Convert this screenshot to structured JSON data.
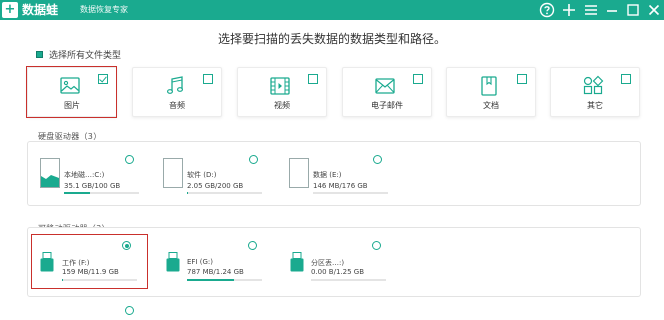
{
  "titlebar": {
    "logo": "+",
    "app_name": "数据蛙",
    "subtitle": "数据恢复专家",
    "color": "#1aaa8f"
  },
  "headline": "选择要扫描的丢失数据的数据类型和路径。",
  "select_all_label": "选择所有文件类型",
  "file_types": [
    {
      "label": "图片",
      "icon": "image-icon",
      "checked": true
    },
    {
      "label": "音频",
      "icon": "music-icon",
      "checked": false
    },
    {
      "label": "视频",
      "icon": "video-icon",
      "checked": false
    },
    {
      "label": "电子邮件",
      "icon": "mail-icon",
      "checked": false
    },
    {
      "label": "文档",
      "icon": "document-icon",
      "checked": false
    },
    {
      "label": "其它",
      "icon": "other-icon",
      "checked": false
    }
  ],
  "hard_drives": {
    "title": "硬盘驱动器（3）",
    "items": [
      {
        "name": "本地磁…:C:)",
        "size": "35.1 GB/100 GB",
        "used_fraction": 0.35,
        "selected": false
      },
      {
        "name": "软件 (D:)",
        "size": "2.05 GB/200 GB",
        "used_fraction": 0.01,
        "selected": false
      },
      {
        "name": "数据 (E:)",
        "size": "146 MB/176 GB",
        "used_fraction": 0.001,
        "selected": false
      }
    ]
  },
  "removable_drives": {
    "title": "可移动驱动器（3）",
    "items": [
      {
        "name": "工作 (F:)",
        "size": "159 MB/11.9 GB",
        "used_fraction": 0.013,
        "selected": true
      },
      {
        "name": "EFI (G:)",
        "size": "787 MB/1.24 GB",
        "used_fraction": 0.63,
        "selected": false
      },
      {
        "name": "分区丢…:)",
        "size": "0.00 B/1.25 GB",
        "used_fraction": 0.0,
        "selected": false
      }
    ]
  }
}
